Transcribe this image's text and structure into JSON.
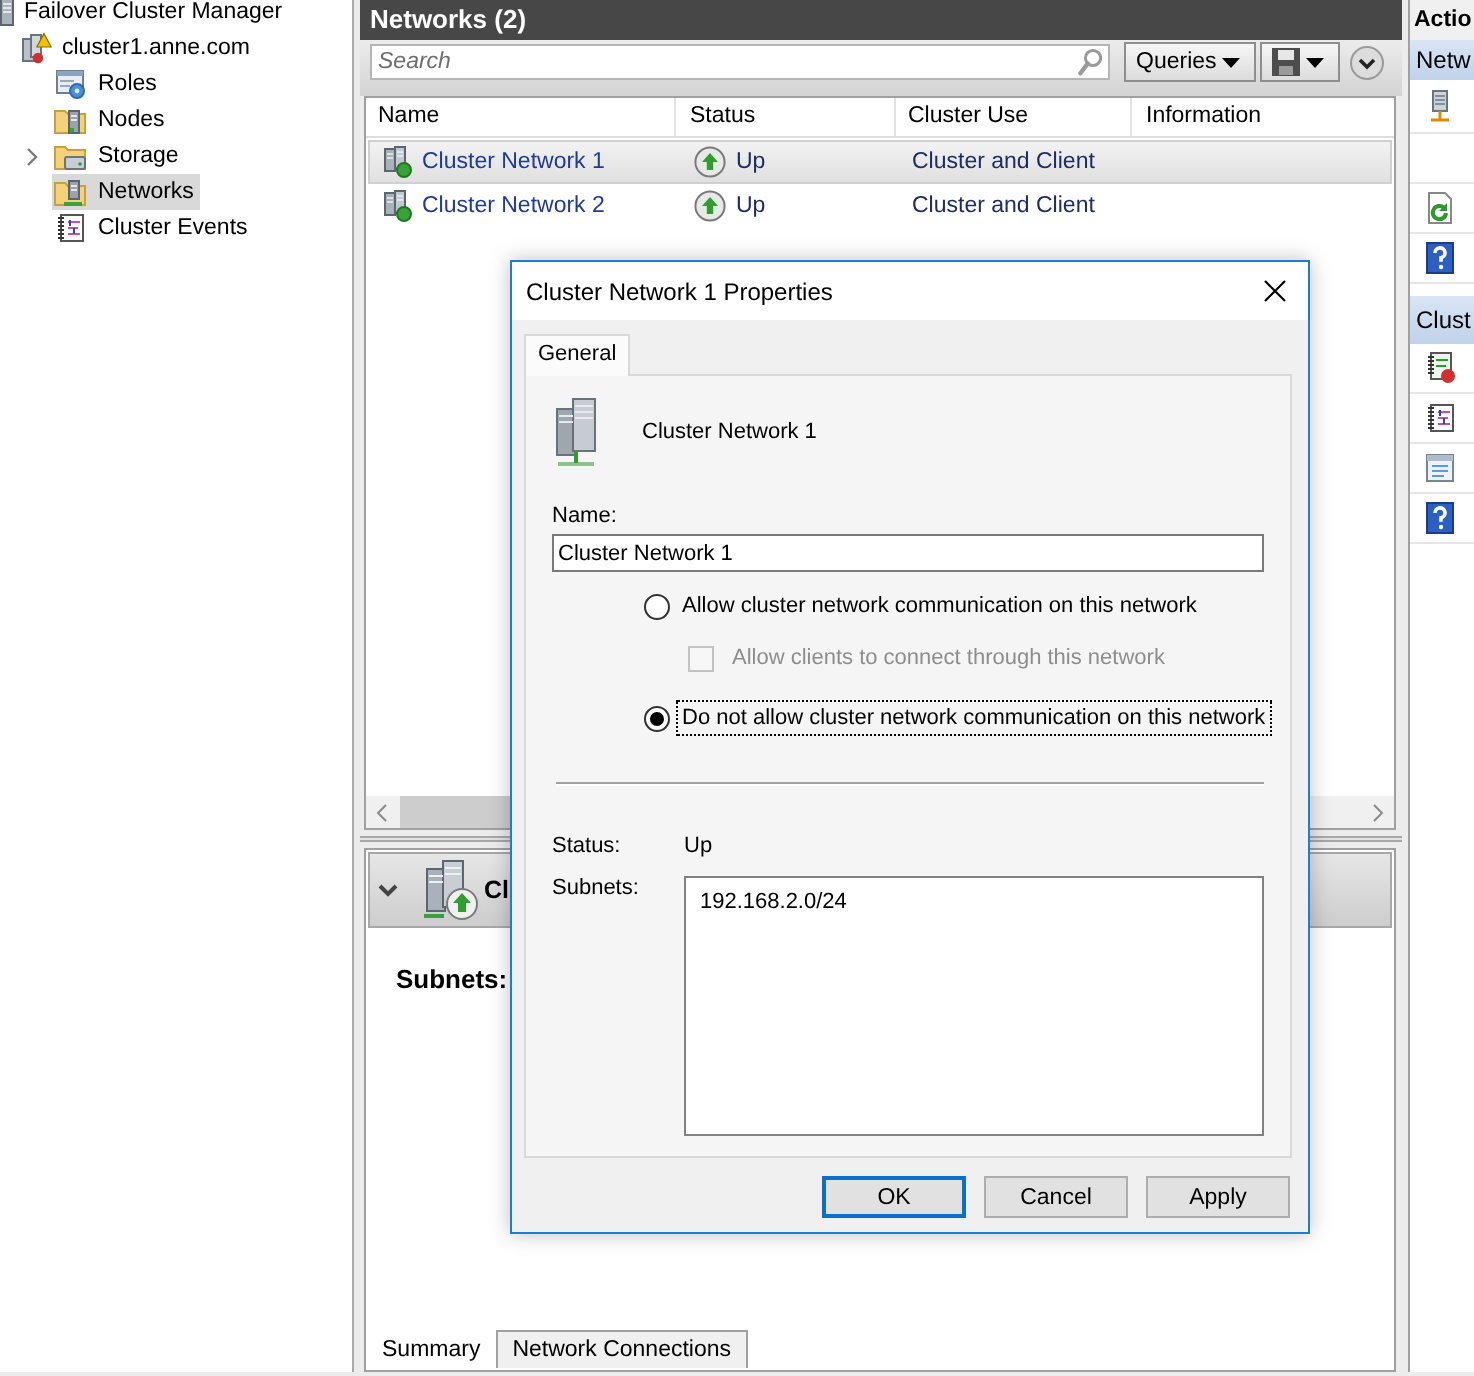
{
  "tree": {
    "label": "Failover Cluster Manager",
    "children": [
      {
        "label": "cluster1.anne.com",
        "children": [
          {
            "label": "Roles",
            "has_children": false,
            "selected": false
          },
          {
            "label": "Nodes",
            "has_children": false,
            "selected": false
          },
          {
            "label": "Storage",
            "has_children": true,
            "selected": false
          },
          {
            "label": "Networks",
            "has_children": false,
            "selected": true
          },
          {
            "label": "Cluster Events",
            "has_children": false,
            "selected": false
          }
        ]
      }
    ]
  },
  "networks_pane": {
    "title": "Networks (2)",
    "search": {
      "placeholder": "Search"
    },
    "queries_button": "Queries",
    "table": {
      "columns": [
        "Name",
        "Status",
        "Cluster Use",
        "Information"
      ],
      "rows": [
        {
          "name": "Cluster Network 1",
          "status": "Up",
          "cluster_use": "Cluster and Client",
          "selected": true
        },
        {
          "name": "Cluster Network 2",
          "status": "Up",
          "cluster_use": "Cluster and Client",
          "selected": false
        }
      ]
    },
    "details": {
      "title": "Cl",
      "subnets_label": "Subnets:",
      "tabs": [
        {
          "label": "Summary",
          "selected": true
        },
        {
          "label": "Network Connections",
          "selected": false
        }
      ]
    }
  },
  "actions_pane": {
    "title": "Actio",
    "sections": [
      {
        "title": "Netw"
      },
      {
        "title": "Clust"
      }
    ]
  },
  "dialog": {
    "title": "Cluster Network 1 Properties",
    "tabs": [
      {
        "label": "General",
        "selected": true
      }
    ],
    "network_name": "Cluster Network 1",
    "name_field": {
      "label": "Name:",
      "value": "Cluster Network 1"
    },
    "options": [
      {
        "kind": "radio",
        "label": "Allow cluster network communication on this network",
        "selected": false,
        "disabled": false,
        "focused": false
      },
      {
        "kind": "checkbox",
        "label": "Allow clients to connect through this network",
        "checked": false,
        "disabled": true,
        "focused": false
      },
      {
        "kind": "radio",
        "label": "Do not allow cluster network communication on this network",
        "selected": true,
        "disabled": false,
        "focused": true
      }
    ],
    "status": {
      "label": "Status:",
      "value": "Up"
    },
    "subnets": {
      "label": "Subnets:",
      "items": [
        "192.168.2.0/24"
      ]
    },
    "buttons": [
      {
        "label": "OK",
        "default": true
      },
      {
        "label": "Cancel",
        "default": false
      },
      {
        "label": "Apply",
        "default": false
      }
    ]
  }
}
